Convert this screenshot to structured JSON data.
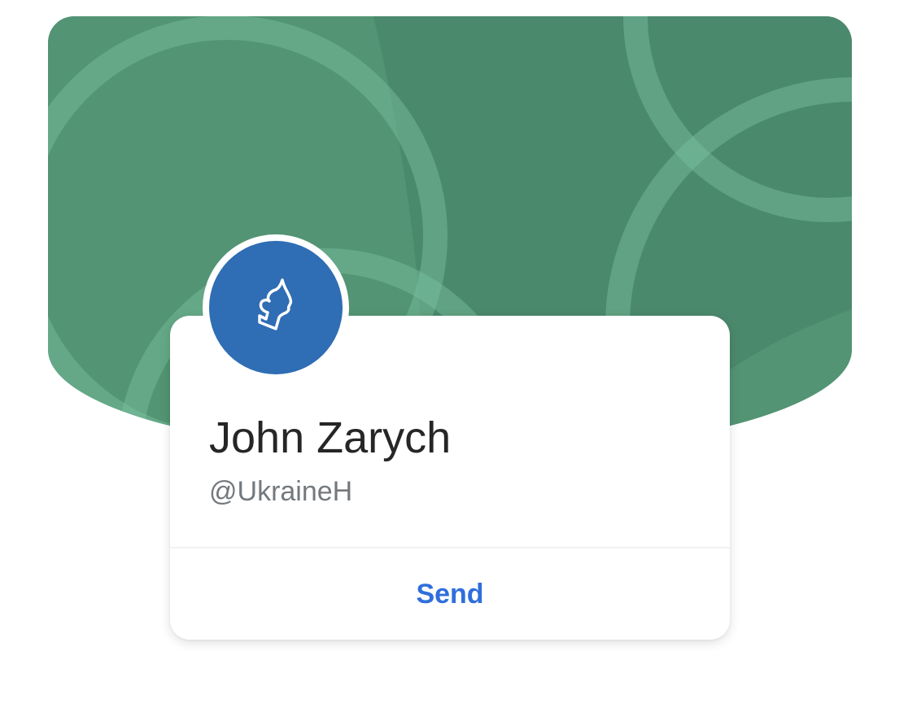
{
  "colors": {
    "banner_base": "#529473",
    "banner_shade": "#4a876b",
    "ring": "#7ac0a0",
    "avatar_bg": "#2f6db4",
    "send_text": "#2f6edb"
  },
  "avatar": {
    "icon": "flame-outline-icon"
  },
  "profile": {
    "name": "John Zarych",
    "handle": "@UkraineH"
  },
  "actions": {
    "send_label": "Send"
  }
}
